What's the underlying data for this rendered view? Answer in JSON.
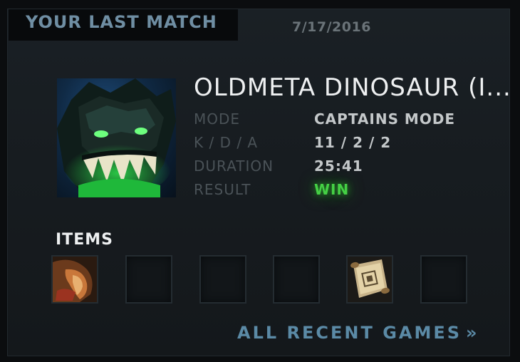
{
  "header": {
    "title": "YOUR LAST MATCH",
    "date": "7/17/2016"
  },
  "hero": {
    "icon": "hero-portrait-icon",
    "accent_color": "#2dd84a"
  },
  "player": {
    "name": "OLDMETA DINOSAUR (I..."
  },
  "stats": [
    {
      "label": "MODE",
      "value": "CAPTAINS MODE"
    },
    {
      "label": "K / D / A",
      "value": "11 / 2 / 2"
    },
    {
      "label": "DURATION",
      "value": "25:41"
    },
    {
      "label": "RESULT",
      "value": "WIN"
    }
  ],
  "result_color": "#45d045",
  "items": {
    "title": "ITEMS",
    "slots": [
      {
        "icon": "boots-item-icon",
        "empty": false
      },
      {
        "icon": "empty-slot",
        "empty": true
      },
      {
        "icon": "empty-slot",
        "empty": true
      },
      {
        "icon": "empty-slot",
        "empty": true
      },
      {
        "icon": "scroll-item-icon",
        "empty": false
      },
      {
        "icon": "empty-slot",
        "empty": true
      }
    ]
  },
  "footer": {
    "link_label": "ALL RECENT GAMES",
    "link_arrow": "»"
  }
}
